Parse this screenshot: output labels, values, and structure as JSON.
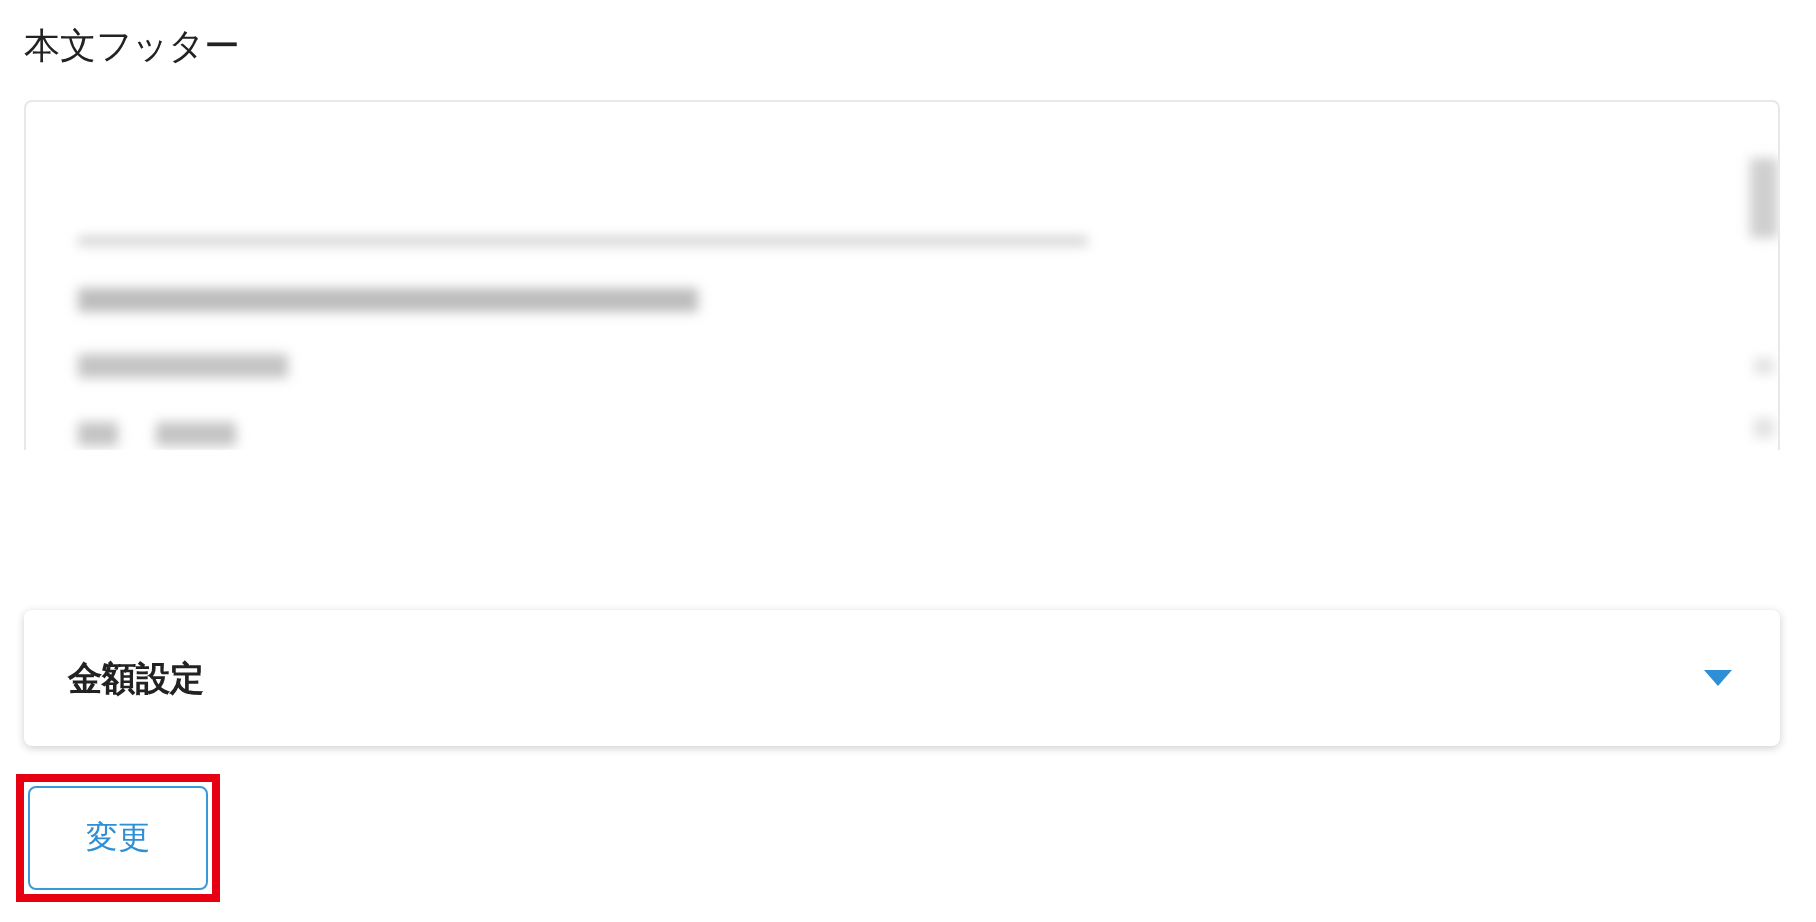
{
  "footer_section": {
    "title": "本文フッター"
  },
  "accordion": {
    "title": "金額設定",
    "expanded": false
  },
  "change_button": {
    "label": "変更",
    "highlighted": true
  }
}
